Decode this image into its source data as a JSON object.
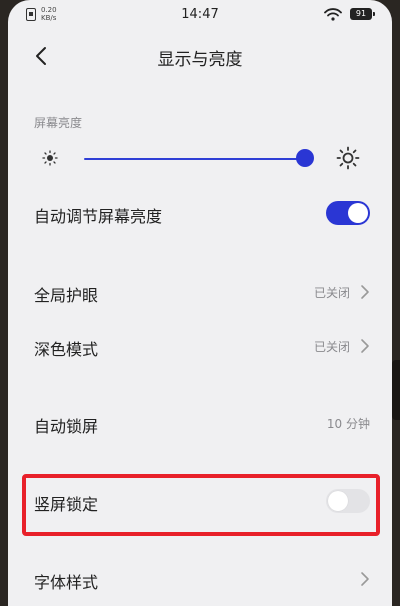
{
  "status_bar": {
    "net_speed_value": "0.20",
    "net_speed_unit": "KB/s",
    "time": "14:47",
    "battery": "91"
  },
  "nav": {
    "title": "显示与亮度"
  },
  "brightness": {
    "section_label": "屏幕亮度",
    "level": 0.95
  },
  "settings": {
    "auto_brightness": {
      "label": "自动调节屏幕亮度",
      "on": true
    },
    "eye_protection": {
      "label": "全局护眼",
      "value": "已关闭"
    },
    "dark_mode": {
      "label": "深色模式",
      "value": "已关闭"
    },
    "auto_lock": {
      "label": "自动锁屏",
      "value": "10 分钟"
    },
    "portrait_lock": {
      "label": "竖屏锁定",
      "on": false
    },
    "font_style": {
      "label": "字体样式"
    }
  },
  "colors": {
    "accent": "#2a36d4",
    "highlight": "#e8202a"
  }
}
